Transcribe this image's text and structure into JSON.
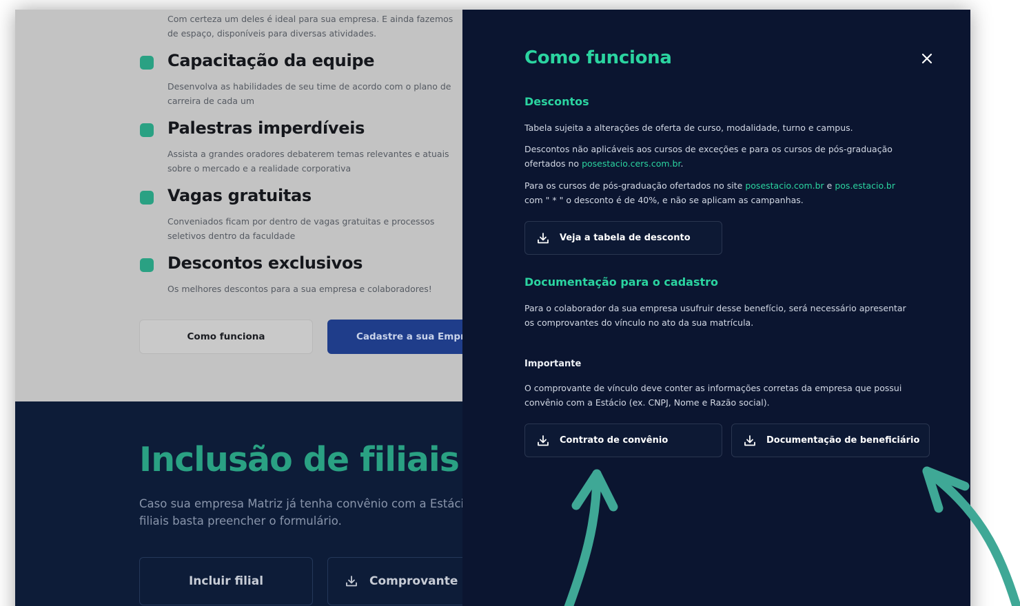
{
  "left_page": {
    "intro": [
      "Com certeza um deles é ideal para sua empresa. E ainda fazemos",
      "de espaço, disponíveis para diversas atividades."
    ],
    "features": [
      {
        "title": "Capacitação da equipe",
        "desc": "Desenvolva as habilidades de seu time de acordo com o plano de carreira de cada um"
      },
      {
        "title": "Palestras imperdíveis",
        "desc": "Assista a grandes oradores debaterem temas relevantes e atuais sobre o mercado e a realidade corporativa"
      },
      {
        "title": "Vagas gratuitas",
        "desc": "Conveniados ficam por dentro de vagas gratuitas e processos seletivos dentro da faculdade"
      },
      {
        "title": "Descontos exclusivos",
        "desc": "Os melhores descontos para a sua empresa e colaboradores!"
      }
    ],
    "btn_como_funciona": "Como funciona",
    "btn_cadastre": "Cadastre a sua Empre",
    "filiais_title": "Inclusão de filiais",
    "filiais_desc": "Caso sua empresa Matriz já tenha convênio com a Estácio suas filiais basta preencher o formulário.",
    "btn_incluir_filial": "Incluir filial",
    "btn_comprovante": "Comprovante"
  },
  "drawer": {
    "title": "Como funciona",
    "close_icon": "close-icon",
    "descontos": {
      "title": "Descontos",
      "p1": "Tabela sujeita a alterações de oferta de curso, modalidade, turno e campus.",
      "p2_text": "Descontos não aplicáveis aos cursos de exceções e para os cursos de pós-graduação ofertados no ",
      "p2_link": "posestacio.cers.com.br",
      "p2_end": ".",
      "p3_text": "Para os cursos de pós-graduação ofertados no site ",
      "p3_link1": "posestacio.com.br",
      "p3_mid": " e ",
      "p3_link2": "pos.estacio.br",
      "p3_end": " com \" * \" o desconto é de 40%, e não se aplicam as campanhas.",
      "button": "Veja a tabela de desconto"
    },
    "documentacao": {
      "title": "Documentação para o cadastro",
      "p1": "Para o colaborador da sua empresa usufruir desse benefício, será necessário apresentar os comprovantes do vínculo no ato da sua matrícula.",
      "importante_title": "Importante",
      "importante_text": "O comprovante de vínculo deve conter as informações corretas da empresa que possui convênio com a Estácio (ex. CNPJ, Nome e Razão social).",
      "btn_contrato": "Contrato de convênio",
      "btn_beneficiario": "Documentação de beneficiário"
    }
  },
  "colors": {
    "accent_green": "#2bd4a0",
    "drawer_bg": "#0b1530",
    "annotation_arrow": "#3fa896"
  }
}
